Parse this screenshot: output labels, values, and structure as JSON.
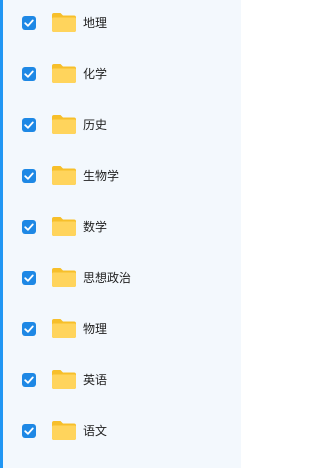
{
  "list": {
    "items": [
      {
        "label": "地理",
        "checked": true,
        "icon": "folder-icon"
      },
      {
        "label": "化学",
        "checked": true,
        "icon": "folder-icon"
      },
      {
        "label": "历史",
        "checked": true,
        "icon": "folder-icon"
      },
      {
        "label": "生物学",
        "checked": true,
        "icon": "folder-icon"
      },
      {
        "label": "数学",
        "checked": true,
        "icon": "folder-icon"
      },
      {
        "label": "思想政治",
        "checked": true,
        "icon": "folder-icon"
      },
      {
        "label": "物理",
        "checked": true,
        "icon": "folder-icon"
      },
      {
        "label": "英语",
        "checked": true,
        "icon": "folder-icon"
      },
      {
        "label": "语文",
        "checked": true,
        "icon": "folder-icon"
      }
    ]
  },
  "colors": {
    "accent": "#2196f3",
    "checkbox": "#1e88e5",
    "folder_body": "#ffd45c",
    "folder_back": "#f7bf2a",
    "background": "#f3f8fd"
  }
}
